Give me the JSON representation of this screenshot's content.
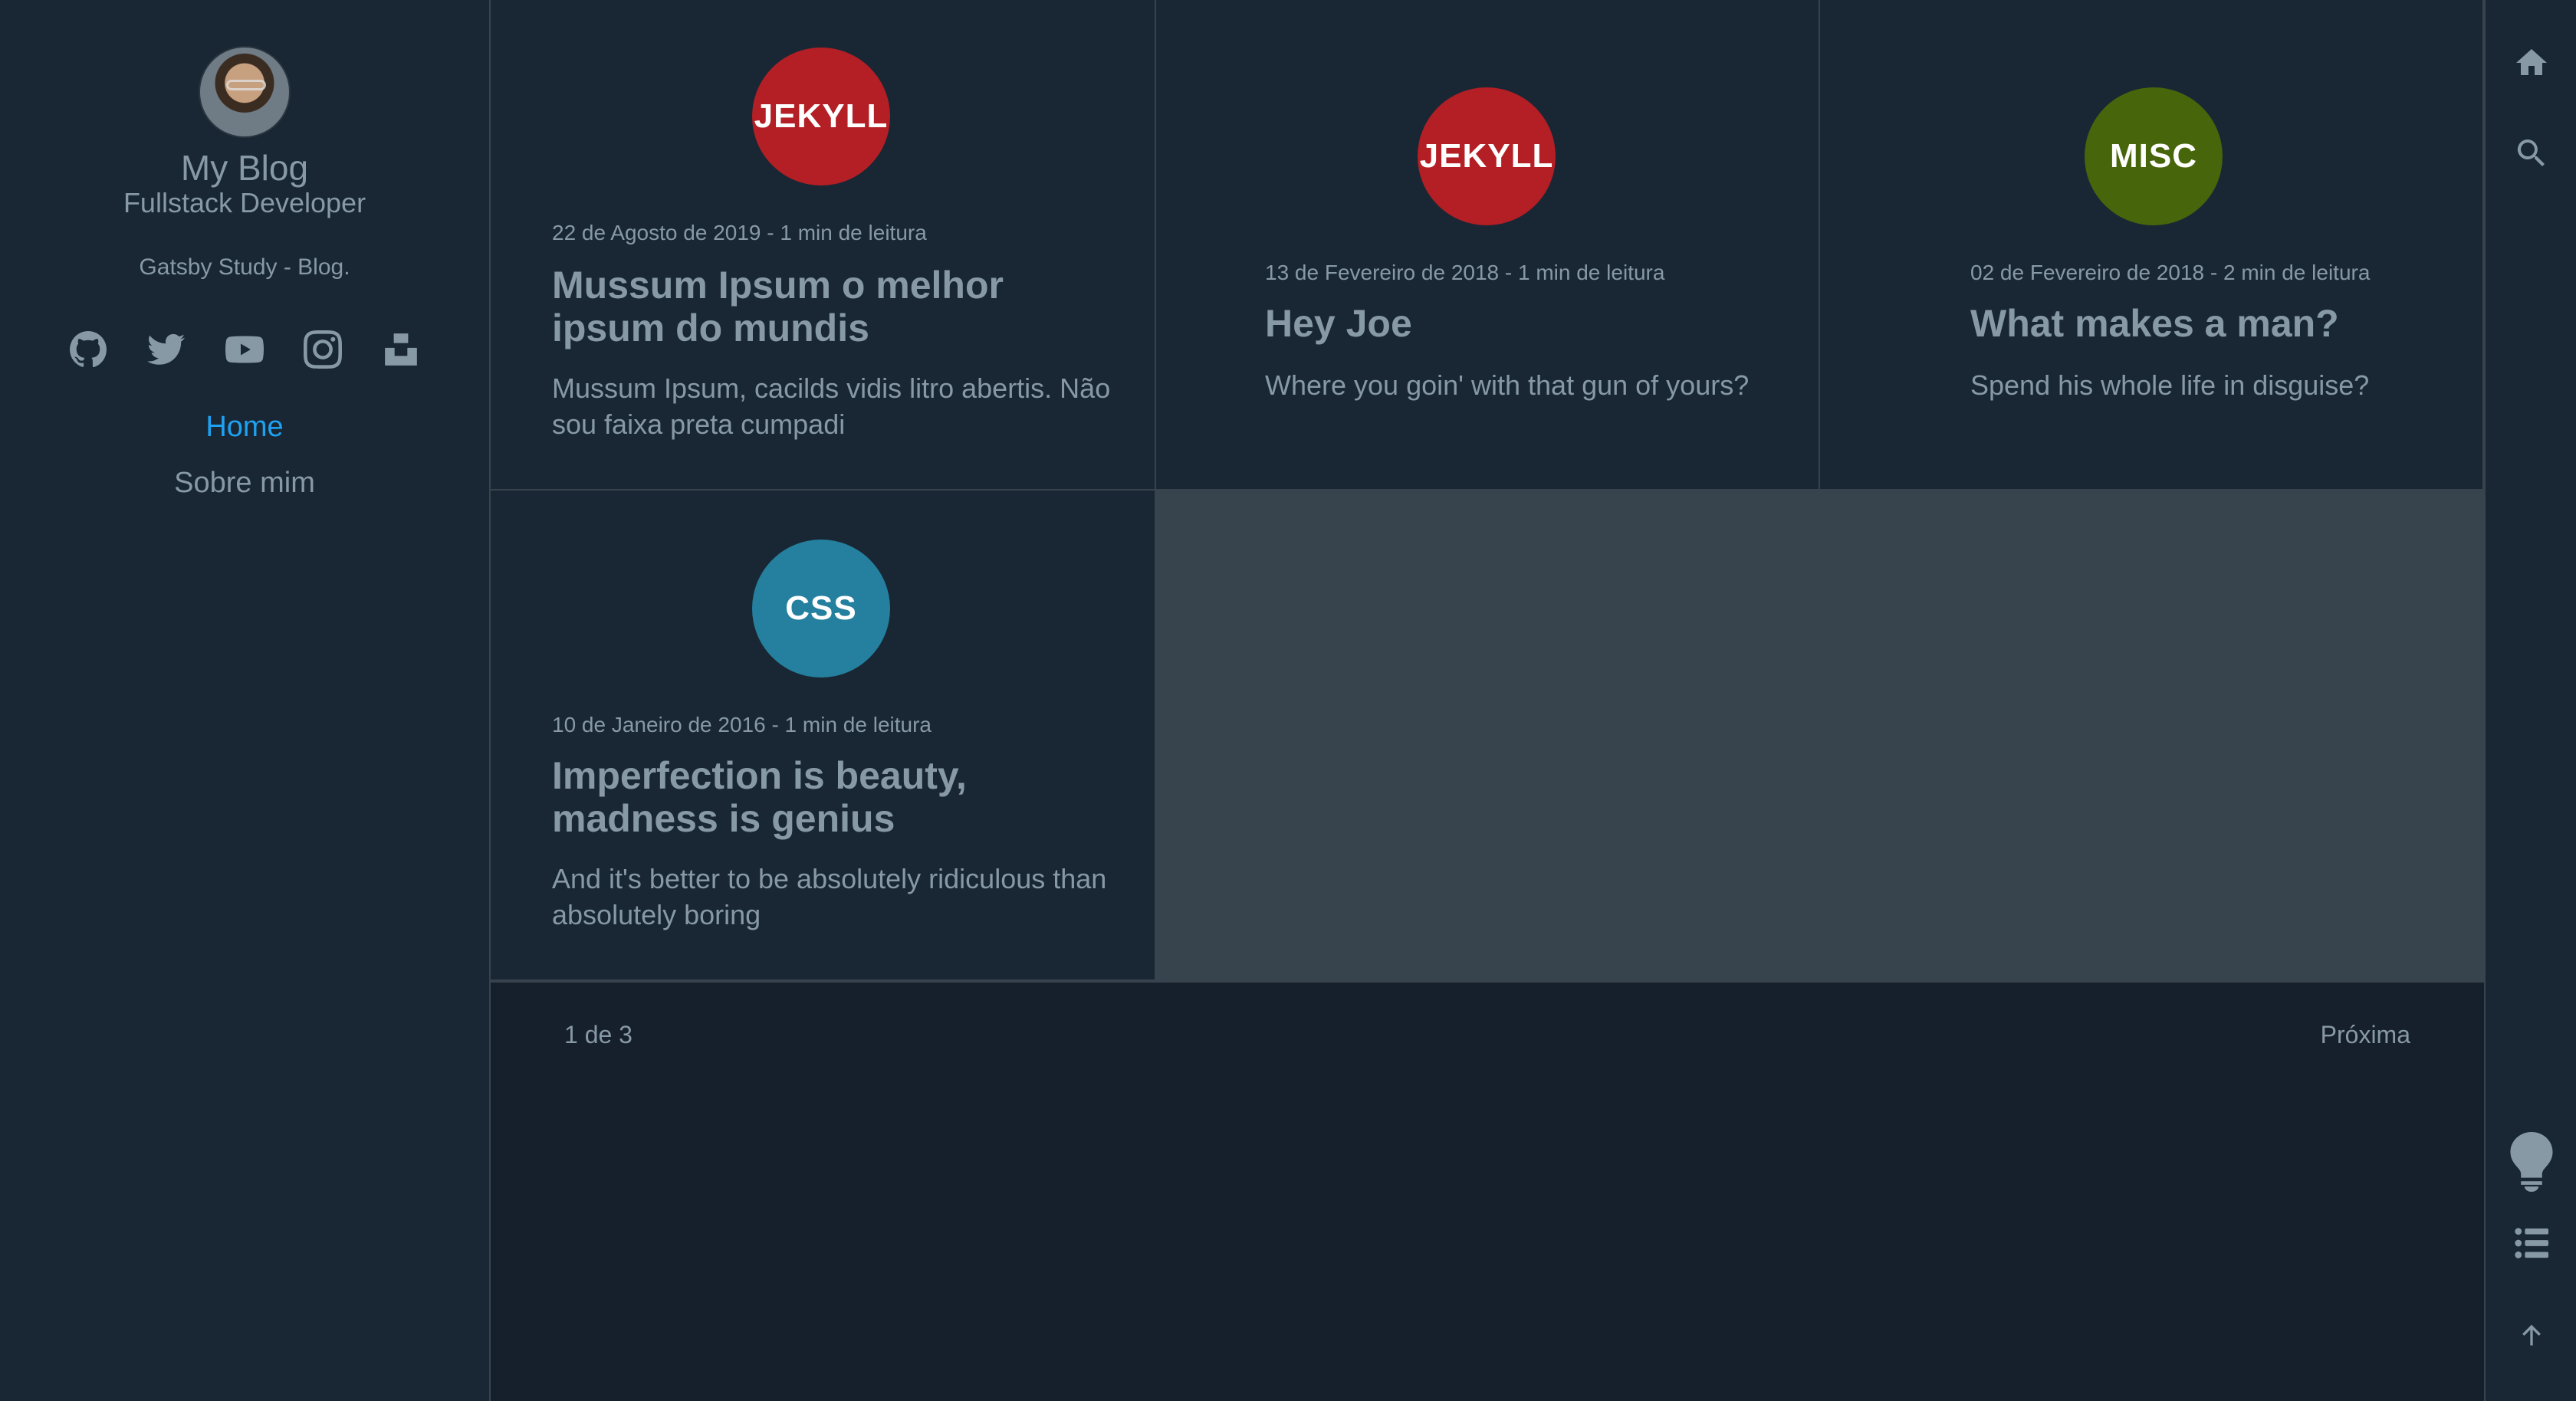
{
  "sidebar": {
    "title": "My Blog",
    "subtitle": "Fullstack Developer",
    "description": "Gatsby Study - Blog.",
    "social": [
      "github-icon",
      "twitter-icon",
      "youtube-icon",
      "instagram-icon",
      "unsplash-icon"
    ],
    "menu": [
      {
        "label": "Home",
        "active": true
      },
      {
        "label": "Sobre mim",
        "active": false
      }
    ]
  },
  "posts": [
    {
      "tag": "JEKYLL",
      "tag_color": "#b31f24",
      "meta": "22 de Agosto de 2019 - 1 min de leitura",
      "title": "Mussum Ipsum o melhor ipsum do mundis",
      "excerpt": "Mussum Ipsum, cacilds vidis litro abertis. Não sou faixa preta cumpadi"
    },
    {
      "tag": "JEKYLL",
      "tag_color": "#b31f24",
      "meta": "13 de Fevereiro de 2018 - 1 min de leitura",
      "title": "Hey Joe",
      "excerpt": "Where you goin' with that gun of yours?"
    },
    {
      "tag": "MISC",
      "tag_color": "#47650b",
      "meta": "02 de Fevereiro de 2018 - 2 min de leitura",
      "title": "What makes a man?",
      "excerpt": "Spend his whole life in disguise?"
    },
    {
      "tag": "CSS",
      "tag_color": "#24809e",
      "meta": "10 de Janeiro de 2016 - 1 min de leitura",
      "title": "Imperfection is beauty, madness is genius",
      "excerpt": "And it's better to be absolutely ridiculous than absolutely boring"
    }
  ],
  "pagination": {
    "current": "1 de 3",
    "next": "Próxima"
  },
  "rightbar": [
    "home-icon",
    "search-icon",
    "lightbulb-icon",
    "list-icon",
    "arrow-up-icon"
  ],
  "colors": {
    "background": "#16202c",
    "panel": "#192734",
    "border": "#38444d",
    "text": "#8899a6",
    "accent": "#1fa1f2"
  }
}
